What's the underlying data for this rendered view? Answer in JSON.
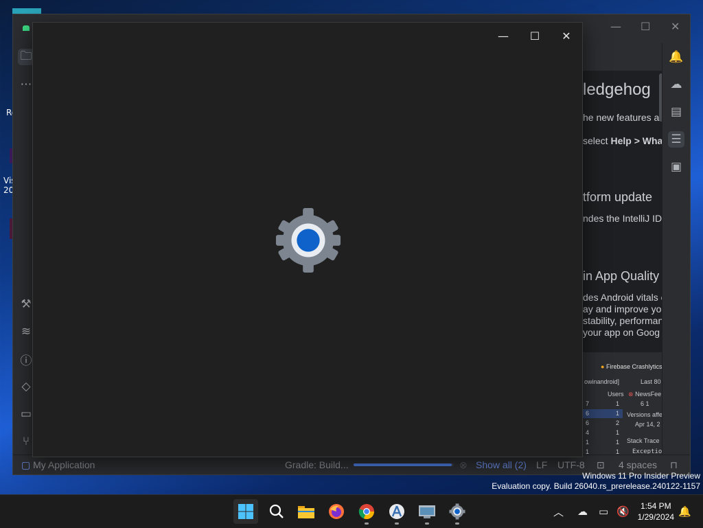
{
  "desktop": {
    "labels": [
      "Re",
      "Vis",
      "20"
    ]
  },
  "ide": {
    "project_name": "My Application",
    "content": {
      "heading_1": "ledgehog",
      "line_1": "he new features ar",
      "line_2_prefix": "select ",
      "line_2_bold": "Help > What",
      "heading_2": "tform update",
      "line_3": "ndes the IntelliJ IDE",
      "heading_3": "in App Quality",
      "line_4": "des Android vitals c",
      "line_5": "ay and improve you",
      "line_6": "stability, performan",
      "line_7": "your app on Goog"
    },
    "crash_panel": {
      "title": "Firebase Crashlytics",
      "filter": "owinandroid]",
      "range": "Last 80",
      "users_header": "Users",
      "issue": "NewsFee",
      "stats": "6   1",
      "versions": "Versions affe",
      "date": "Apr 14, 2",
      "stack_trace": "Stack Trace",
      "exception": "Exception",
      "rows": [
        {
          "a": "7",
          "b": "1"
        },
        {
          "a": "6",
          "b": "1"
        },
        {
          "a": "6",
          "b": "2"
        },
        {
          "a": "4",
          "b": "1"
        },
        {
          "a": "1",
          "b": "1"
        },
        {
          "a": "1",
          "b": "1"
        },
        {
          "a": "1",
          "b": "1"
        }
      ]
    },
    "status": {
      "gradle": "Gradle: Build...",
      "progress_fraction": 0.98,
      "show_all": "Show all (2)",
      "line_sep": "LF",
      "encoding": "UTF-8",
      "indent": "4 spaces"
    }
  },
  "splash": {
    "icon": "settings-gear-icon"
  },
  "watermark": {
    "line_1": "Windows 11 Pro Insider Preview",
    "line_2": "Evaluation copy. Build 26040.rs_prerelease.240122-1157"
  },
  "taskbar": {
    "apps": [
      "start",
      "search",
      "file-explorer",
      "firefox",
      "chrome",
      "android-studio",
      "virtual-machine",
      "settings"
    ],
    "time": "1:54 PM",
    "date": "1/29/2024"
  },
  "colors": {
    "accent": "#0f62c9",
    "progress": "#4b7be0",
    "link": "#6b8de6"
  }
}
